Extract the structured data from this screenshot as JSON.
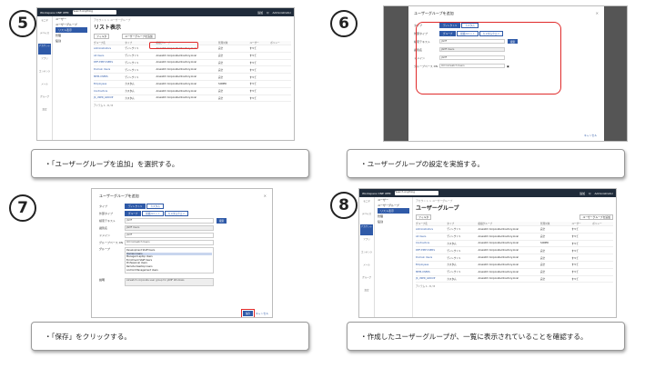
{
  "steps": {
    "s5": {
      "num": "5",
      "caption": "・「ユーザーグループを追加」を選択する。"
    },
    "s6": {
      "num": "6",
      "caption": "・ユーザーグループの設定を実施する。"
    },
    "s7": {
      "num": "7",
      "caption": "・「保存」をクリックする。"
    },
    "s8": {
      "num": "8",
      "caption": "・作成したユーザーグループが、一覧に表示されていることを確認する。"
    }
  },
  "app": {
    "name": "Workspace ONE UEM",
    "search_placeholder": "Search Anything",
    "top_right": [
      "追加",
      "Q",
      "★",
      "⊕",
      "Administrator"
    ],
    "lnav": [
      "モニタ",
      "デバイス",
      "アカウント",
      "アプリ",
      "コンテンツ",
      "メール",
      "グループ",
      "設定"
    ],
    "snav": [
      "ユーザー",
      "ユーザーグループ",
      "リスト表示",
      "管理",
      "役割"
    ],
    "breadcrumb": "アカウント > ユーザーグループ",
    "title5": "リスト表示",
    "title8": "ユーザーグループ",
    "filter": "フィルタ",
    "add_btn": "ユーザーグループを追加",
    "col": [
      "グループ名",
      "タイプ",
      "組織グループ",
      "管理対象",
      "ユーザー",
      "ポリシー"
    ],
    "rows5": [
      [
        "Administrators",
        "ディレクトリ",
        "Airwatch Corporate.Directory.local",
        "完全",
        "すべて"
      ],
      [
        "All Users",
        "ディレクトリ",
        "Airwatch Corporate.Directory.local",
        "完全",
        "すべて"
      ],
      [
        "DEF-EMP USERS",
        "ディレクトリ",
        "Airwatch Corporate.Directory.local",
        "完全",
        "すべて"
      ],
      [
        "Domain Users",
        "ディレクトリ",
        "Airwatch Corporate.Directory.local",
        "完全",
        "すべて"
      ],
      [
        "MEM-USERS",
        "ディレクトリ",
        "Airwatch Corporate.Directory.local",
        "完全",
        "すべて"
      ],
      [
        "Employees",
        "カスタム",
        "Airwatch Corporate.Directory.local",
        "SCNER",
        "すべて"
      ],
      [
        "Contractors",
        "カスタム",
        "Airwatch Corporate.Directory.local",
        "完全",
        "すべて"
      ],
      [
        "JS_USER_GROUP",
        "カスタム",
        "Airwatch Corporate.Directory.local",
        "完全",
        "すべて"
      ]
    ],
    "rows8": [
      [
        "Administrators",
        "ディレクトリ",
        "Airwatch Corporate.Directory.local",
        "完全",
        "すべて"
      ],
      [
        "All Users",
        "ディレクトリ",
        "Airwatch Corporate.Directory.local",
        "完全",
        "すべて"
      ],
      [
        "Contractors",
        "カスタム",
        "Airwatch Corporate.Directory.local",
        "SCNER",
        "すべて"
      ],
      [
        "DEF-EMP USERS",
        "ディレクトリ",
        "Airwatch Corporate.Directory.local",
        "完全",
        "すべて"
      ],
      [
        "Domain Users",
        "ディレクトリ",
        "Airwatch Corporate.Directory.local",
        "完全",
        "すべて"
      ],
      [
        "Employees",
        "カスタム",
        "Airwatch Corporate.Directory.local",
        "完全",
        "すべて"
      ],
      [
        "MEM-USERS",
        "ディレクトリ",
        "Airwatch Corporate.Directory.local",
        "完全",
        "すべて"
      ],
      [
        "JS_USER_GROUP",
        "カスタム",
        "Airwatch Corporate.Directory.local",
        "完全",
        "すべて"
      ]
    ],
    "footer": "アイテム 1 - 8 / 8"
  },
  "modal": {
    "title": "ユーザーグループを追加",
    "type_label": "タイプ",
    "type_opts": [
      "ディレクトリ",
      "カスタム"
    ],
    "ext_label": "外部タイプ",
    "ext_opts": [
      "グループ",
      "組織ユニット",
      "カスタムクエリ"
    ],
    "search_label": "検索テキスト",
    "search_val": "JAMF",
    "search_btn": "検索",
    "dn_label": "識別名",
    "dn_val": "JAMF Users",
    "domain_label": "ドメイン",
    "domain_val": "JAMF",
    "gbase_label": "グループベース DN",
    "gbase_val": "OU=Airwatch Users",
    "group_label": "グループ",
    "group_list": [
      "Development Staff Users",
      "Domain Users",
      "Managed Laptop Users",
      "Enrollment Staff Users",
      "Professional Users",
      "Remote Desktop Users",
      "Android Management Users"
    ],
    "desc_label": "説明",
    "desc_placeholder": "Airwatch corporate user group for JAMF Windows",
    "save": "保存",
    "cancel": "キャンセル"
  }
}
